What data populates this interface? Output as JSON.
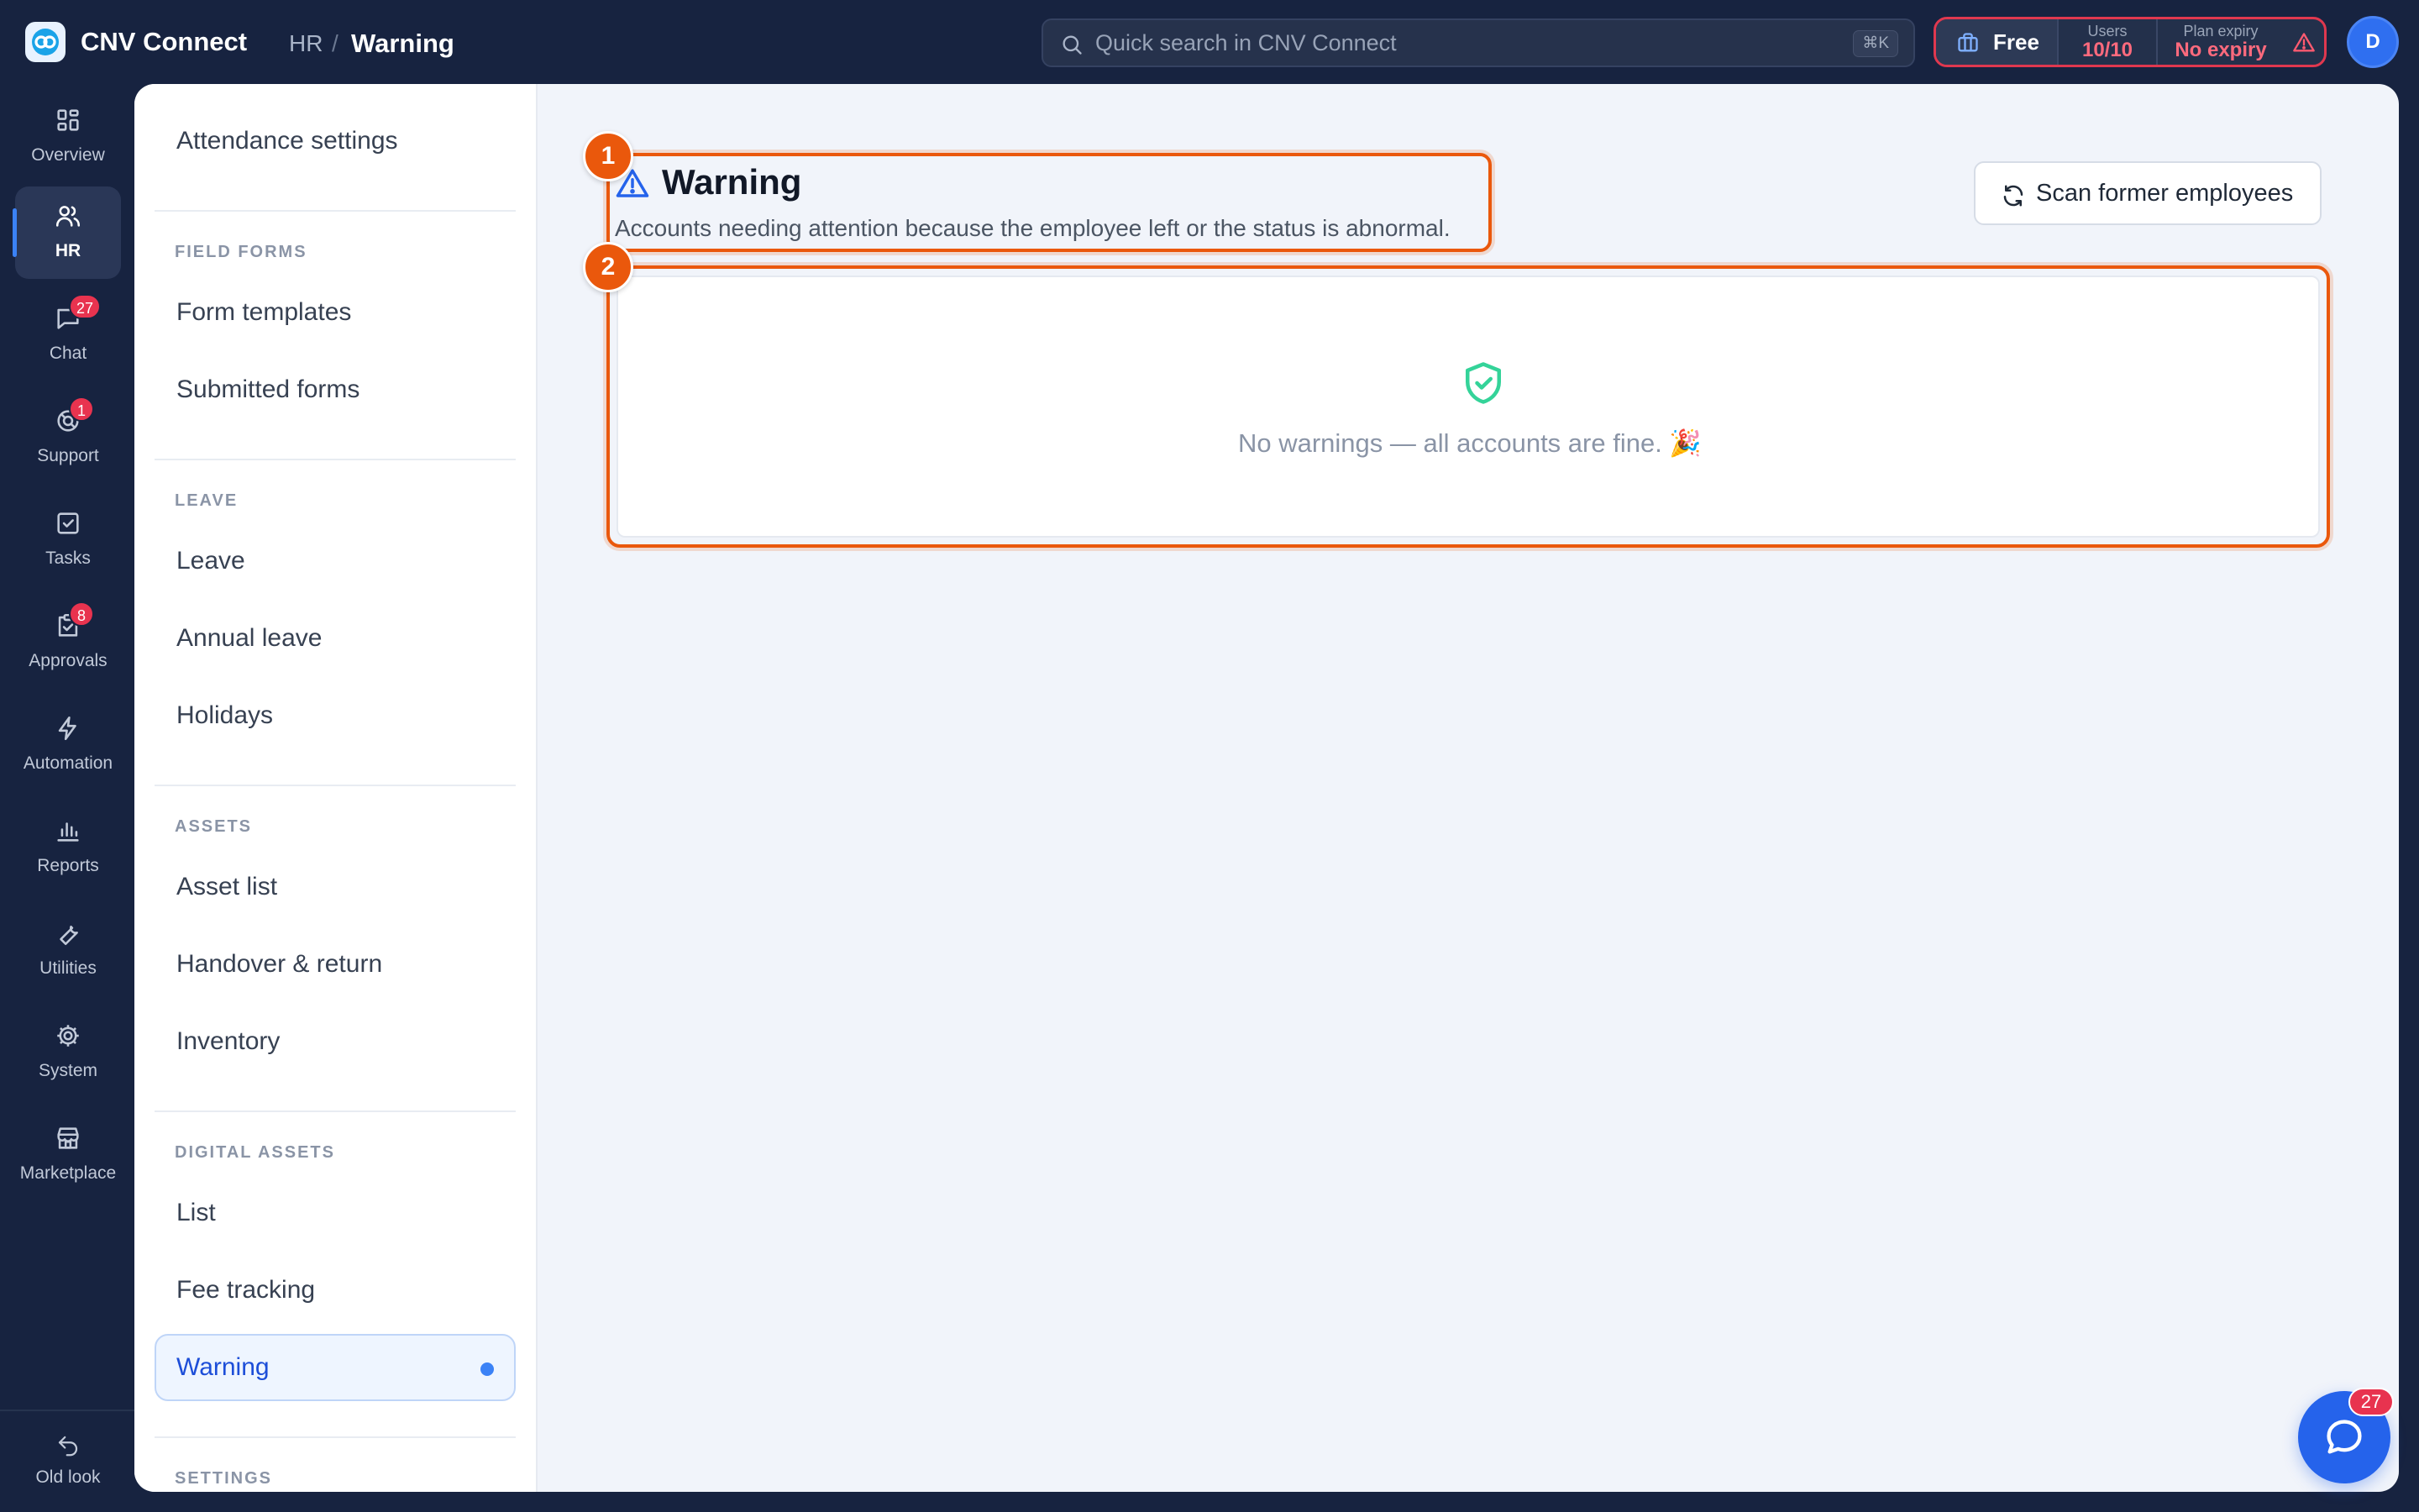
{
  "header": {
    "app_name": "CNV Connect",
    "breadcrumb": {
      "parent": "HR",
      "separator": "/",
      "current": "Warning"
    },
    "search": {
      "placeholder": "Quick search in CNV Connect",
      "shortcut": "⌘K"
    },
    "plan": {
      "name": "Free",
      "users_label": "Users",
      "users_value": "10/10",
      "expiry_label": "Plan expiry",
      "expiry_value": "No expiry"
    },
    "avatar_initial": "D"
  },
  "rail": {
    "items": [
      {
        "label": "Overview",
        "icon": "grid-icon",
        "badge": null
      },
      {
        "label": "HR",
        "icon": "users-icon",
        "badge": null,
        "active": true
      },
      {
        "label": "Chat",
        "icon": "chat-icon",
        "badge": "27"
      },
      {
        "label": "Support",
        "icon": "support-icon",
        "badge": "1"
      },
      {
        "label": "Tasks",
        "icon": "checkbox-icon",
        "badge": null
      },
      {
        "label": "Approvals",
        "icon": "approval-icon",
        "badge": "8"
      },
      {
        "label": "Automation",
        "icon": "lightning-icon",
        "badge": null
      },
      {
        "label": "Reports",
        "icon": "bar-chart-icon",
        "badge": null
      },
      {
        "label": "Utilities",
        "icon": "wrench-icon",
        "badge": null
      },
      {
        "label": "System",
        "icon": "gear-icon",
        "badge": null
      },
      {
        "label": "Marketplace",
        "icon": "store-icon",
        "badge": null
      }
    ],
    "old_look_label": "Old look"
  },
  "subnav": {
    "top_item": "Attendance settings",
    "sections": [
      {
        "heading": "FIELD FORMS",
        "items": [
          "Form templates",
          "Submitted forms"
        ]
      },
      {
        "heading": "LEAVE",
        "items": [
          "Leave",
          "Annual leave",
          "Holidays"
        ]
      },
      {
        "heading": "ASSETS",
        "items": [
          "Asset list",
          "Handover & return",
          "Inventory"
        ]
      },
      {
        "heading": "DIGITAL ASSETS",
        "items": [
          "List",
          "Fee tracking",
          "Warning"
        ]
      },
      {
        "heading": "SETTINGS",
        "items": []
      }
    ],
    "active_item": "Warning"
  },
  "main": {
    "title": "Warning",
    "subtitle": "Accounts needing attention because the employee left or the status is abnormal.",
    "scan_button": "Scan former employees",
    "empty_state": "No warnings — all accounts are fine. 🎉",
    "markers": [
      "1",
      "2"
    ]
  },
  "chat_fab": {
    "badge": "27"
  },
  "colors": {
    "sidebar_bg": "#172340",
    "accent": "#2563eb",
    "highlight": "#ea580c",
    "badge": "#e8334f",
    "success": "#34d399"
  }
}
